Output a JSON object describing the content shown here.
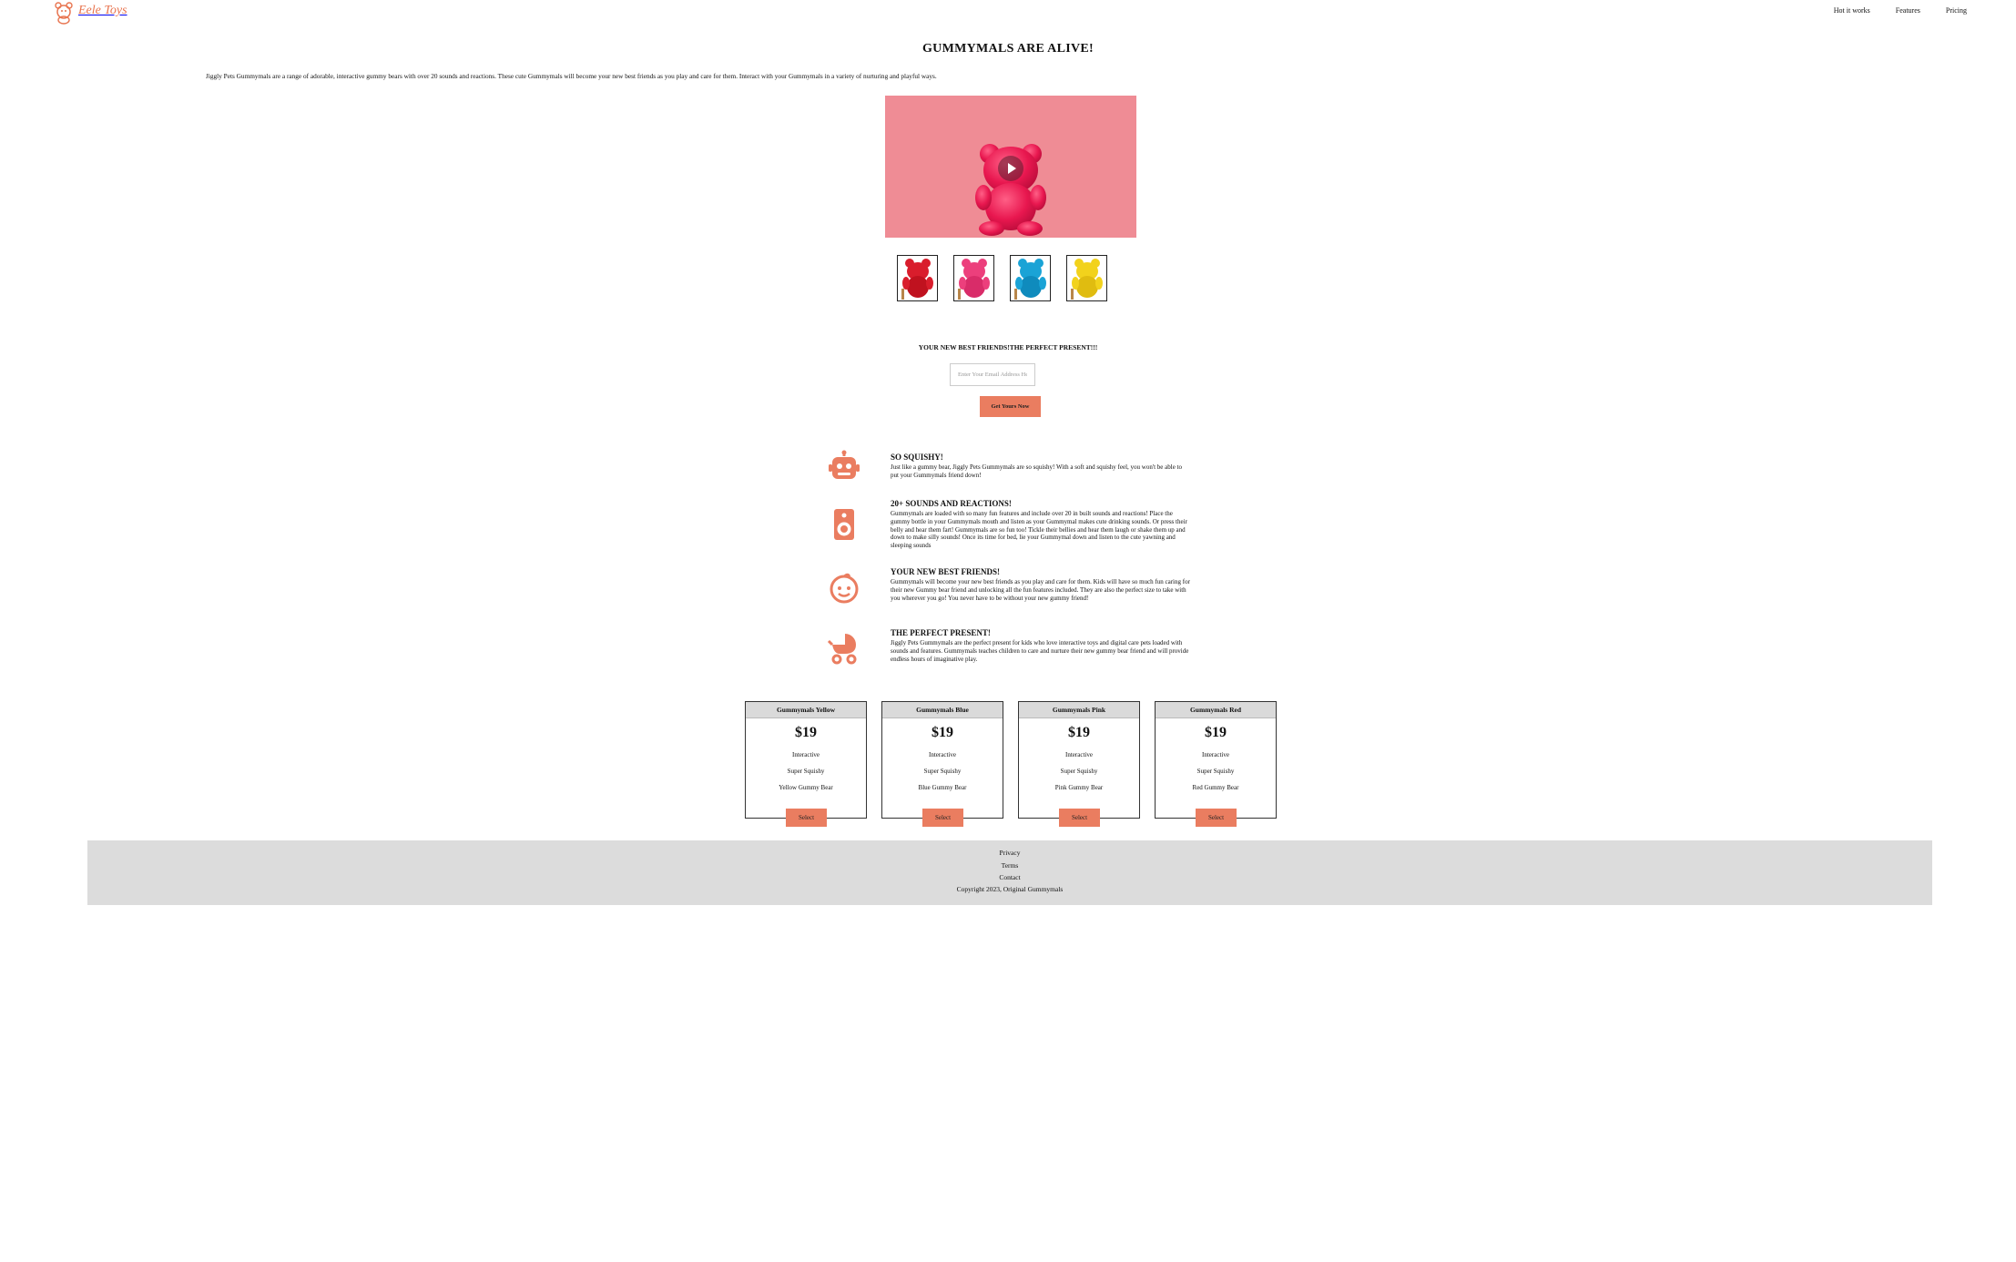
{
  "brand": {
    "name": "Eele Toys",
    "color": "#e8744f"
  },
  "nav": {
    "items": [
      "Hot it works",
      "Features",
      "Pricing"
    ]
  },
  "hero": {
    "title": "GUMMYMALS ARE ALIVE!",
    "intro": "Jiggly Pets Gummymals are a range of adorable, interactive gummy bears with over 20 sounds and reactions. These cute Gummymals will become your new best friends as you play and care for them. Interact with your Gummymals in a variety of nurturing and playful ways.",
    "video_bg": "#ef8c95",
    "thumbnails": [
      {
        "name": "red-bear",
        "color": "#d91d2c"
      },
      {
        "name": "pink-bear",
        "color": "#ec3f7c"
      },
      {
        "name": "blue-bear",
        "color": "#1aa3d6"
      },
      {
        "name": "yellow-bear",
        "color": "#f2d21c"
      }
    ]
  },
  "signup": {
    "heading": "YOUR NEW BEST FRIENDS!THE PERFECT PRESENT!!!",
    "placeholder": "Enter Your Email Address Here...",
    "button": "Get Yours Now"
  },
  "features": [
    {
      "icon": "robot-icon",
      "title": "SO SQUISHY!",
      "text": "Just like a gummy bear, Jiggly Pets Gummymals are so squishy! With a soft and squishy feel, you won't be able to put your Gummymals friend down!"
    },
    {
      "icon": "speaker-icon",
      "title": "20+ SOUNDS AND REACTIONS!",
      "text": "Gummymals are loaded with so many fun features and include over 20 in built sounds and reactions! Place the gummy bottle in your Gummymals mouth and listen as your Gummymal makes cute drinking sounds. Or press their belly and hear them fart! Gummymals are so fun too! Tickle their bellies and hear them laugh or shake them up and down to make silly sounds! Once its time for bed, lie your Gummymal down and listen to the cute yawning and sleeping sounds"
    },
    {
      "icon": "baby-face-icon",
      "title": "YOUR NEW BEST FRIENDS!",
      "text": "Gummymals will become your new best friends as you play and care for them. Kids will have so much fun caring for their new Gummy bear friend and unlocking all the fun features included. They are also the perfect size to take with you wherever you go! You never have to be without your new gummy friend!"
    },
    {
      "icon": "stroller-icon",
      "title": "THE PERFECT PRESENT!",
      "text": "Jiggly Pets Gummymals are the perfect present for kids who love interactive toys and digital care pets loaded with sounds and features. Gummymals teaches children to care and nurture their new gummy bear friend and will provide endless hours of imaginative play."
    }
  ],
  "accent": "#ea7d60",
  "pricing": [
    {
      "name": "Gummymals Yellow",
      "price": "$19",
      "features": [
        "Interactive",
        "Super Squishy",
        "Yellow Gummy Bear"
      ],
      "button": "Select"
    },
    {
      "name": "Gummymals Blue",
      "price": "$19",
      "features": [
        "Interactive",
        "Super Squishy",
        "Blue Gummy Bear"
      ],
      "button": "Select"
    },
    {
      "name": "Gummymals Pink",
      "price": "$19",
      "features": [
        "Interactive",
        "Super Squishy",
        "Pink Gummy Bear"
      ],
      "button": "Select"
    },
    {
      "name": "Gummymals Red",
      "price": "$19",
      "features": [
        "Interactive",
        "Super Squishy",
        "Red Gummy Bear"
      ],
      "button": "Select"
    }
  ],
  "footer": {
    "links": [
      "Privacy",
      "Terms",
      "Contact"
    ],
    "copyright": "Copyright 2023, Original Gummymals"
  }
}
